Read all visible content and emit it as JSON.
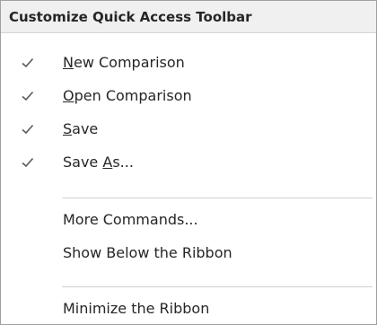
{
  "menu": {
    "title": "Customize Quick Access Toolbar",
    "checked_items": [
      {
        "pre": "",
        "mnemonic": "N",
        "post": "ew Comparison",
        "checked": true
      },
      {
        "pre": "",
        "mnemonic": "O",
        "post": "pen Comparison",
        "checked": true
      },
      {
        "pre": "",
        "mnemonic": "S",
        "post": "ave",
        "checked": true
      },
      {
        "pre": "Save ",
        "mnemonic": "A",
        "post": "s...",
        "checked": true
      }
    ],
    "more_commands": "More Commands...",
    "show_below": "Show Below the Ribbon",
    "minimize": "Minimize the Ribbon"
  },
  "icons": {
    "check": "checkmark-icon"
  },
  "colors": {
    "header_bg": "#f0f0f0",
    "text": "#262626",
    "check": "#595959",
    "separator": "#d0d0d0",
    "border": "#a0a0a0"
  }
}
